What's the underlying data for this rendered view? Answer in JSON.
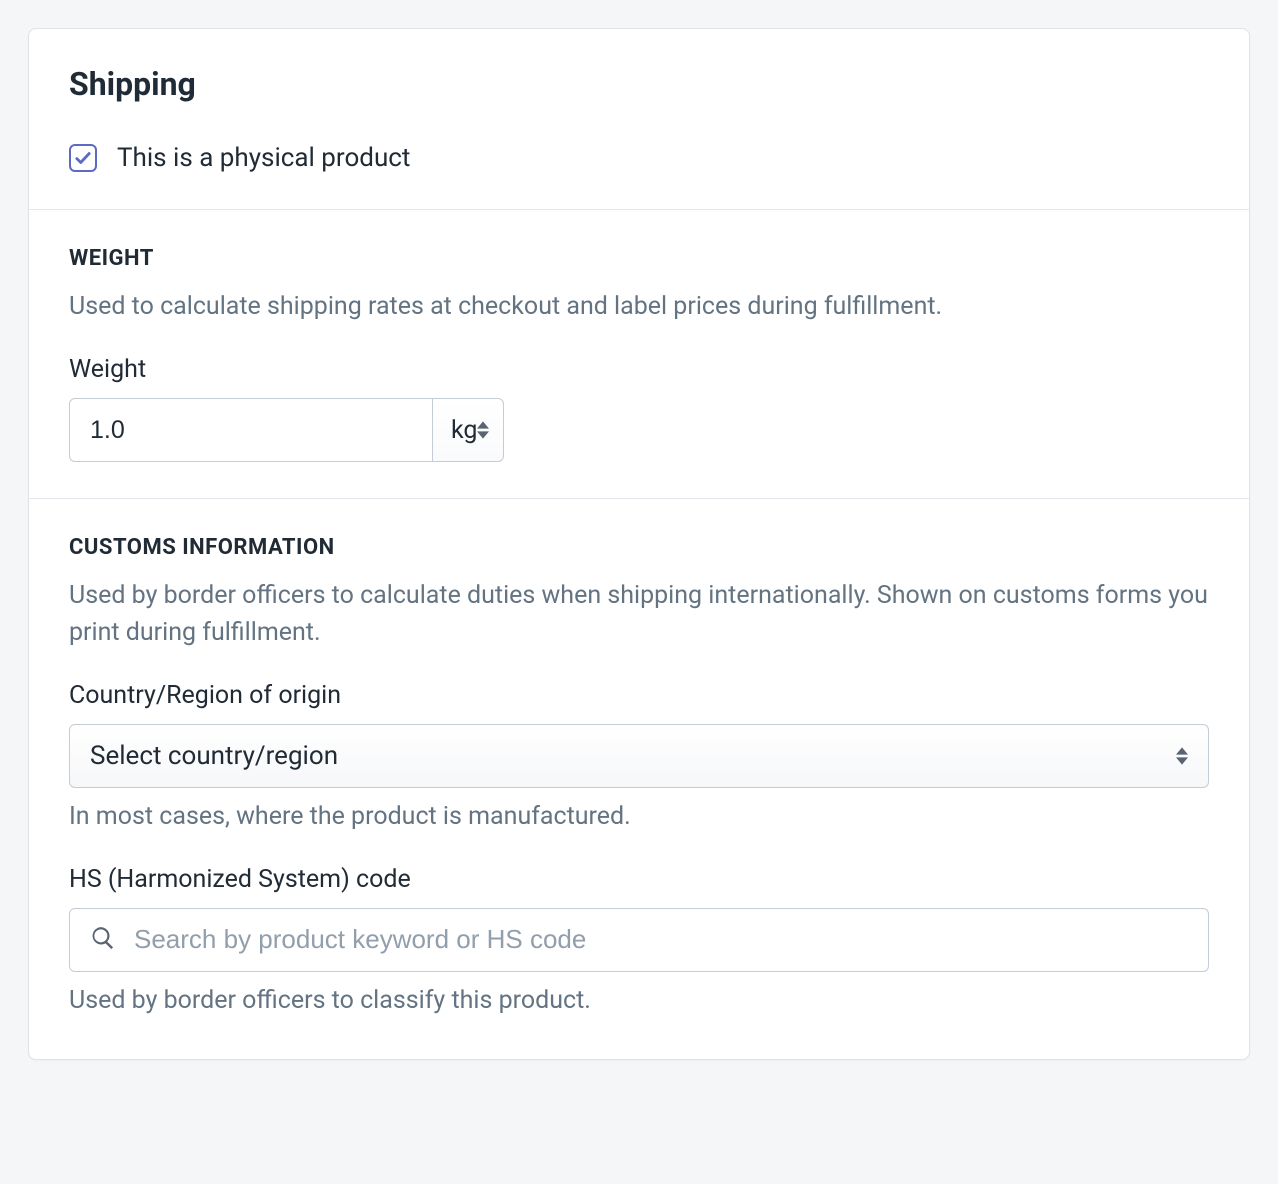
{
  "shipping": {
    "title": "Shipping",
    "physical_product": {
      "label": "This is a physical product",
      "checked": true
    },
    "weight": {
      "heading": "WEIGHT",
      "description": "Used to calculate shipping rates at checkout and label prices during fulfillment.",
      "label": "Weight",
      "value": "1.0",
      "unit": "kg"
    },
    "customs": {
      "heading": "CUSTOMS INFORMATION",
      "description": "Used by border officers to calculate duties when shipping internationally. Shown on customs forms you print during fulfillment.",
      "country": {
        "label": "Country/Region of origin",
        "placeholder": "Select country/region",
        "help": "In most cases, where the product is manufactured."
      },
      "hs": {
        "label": "HS (Harmonized System) code",
        "placeholder": "Search by product keyword or HS code",
        "help": "Used by border officers to classify this product."
      }
    }
  }
}
